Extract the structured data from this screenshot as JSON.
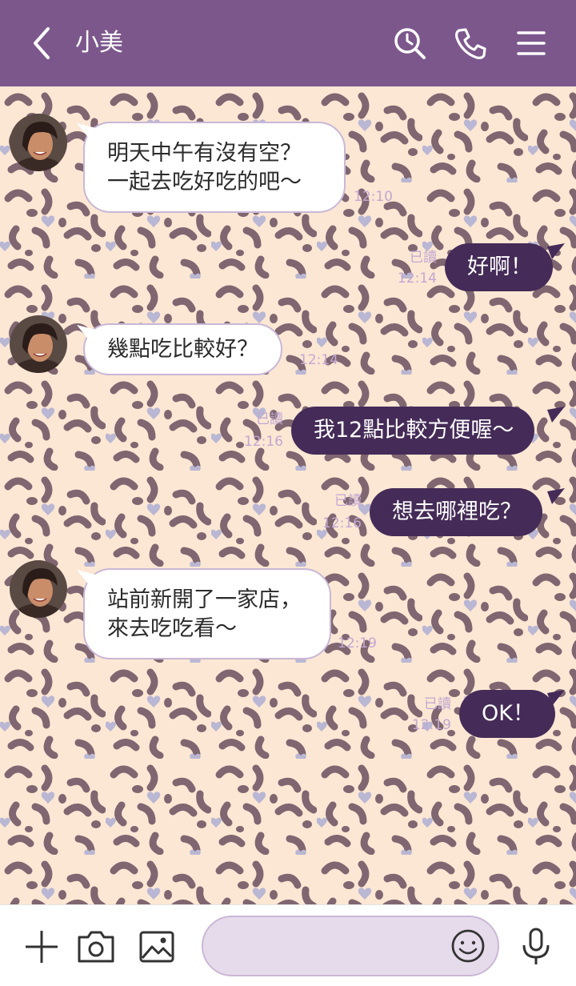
{
  "header": {
    "title": "小美",
    "background_color": "#7c578c",
    "icons": [
      "back-chevron-icon",
      "search-icon",
      "phone-icon",
      "menu-icon"
    ]
  },
  "theme": {
    "chat_background": "leopard print (peach #fce7d4, mauve spots #7f6670, lavender hearts #b9b7d3)",
    "incoming_bubble_color": "#ffffff",
    "outgoing_bubble_color": "#452b57",
    "meta_text_color": "#c2a7d1"
  },
  "messages": [
    {
      "direction": "in",
      "lines": [
        "明天中午有沒有空？",
        "一起去吃好吃的吧～"
      ],
      "time": "12:10"
    },
    {
      "direction": "out",
      "text": "好啊！",
      "read": "已讀",
      "time": "12:14"
    },
    {
      "direction": "in",
      "lines": [
        "幾點吃比較好？"
      ],
      "time": "12:14"
    },
    {
      "direction": "out",
      "text": "我12點比較方便喔～",
      "read": "已讀",
      "time": "12:16"
    },
    {
      "direction": "out",
      "text": "想去哪裡吃？",
      "read": "已讀",
      "time": "12:16"
    },
    {
      "direction": "in",
      "lines": [
        "站前新開了一家店，",
        "來去吃吃看～"
      ],
      "time": "12:19"
    },
    {
      "direction": "out",
      "text": "OK！",
      "read": "已讀",
      "time": "12:19"
    }
  ],
  "input": {
    "placeholder": "",
    "value": ""
  },
  "bottom_icons": [
    "plus-icon",
    "camera-icon",
    "image-icon",
    "emoji-icon",
    "microphone-icon"
  ]
}
